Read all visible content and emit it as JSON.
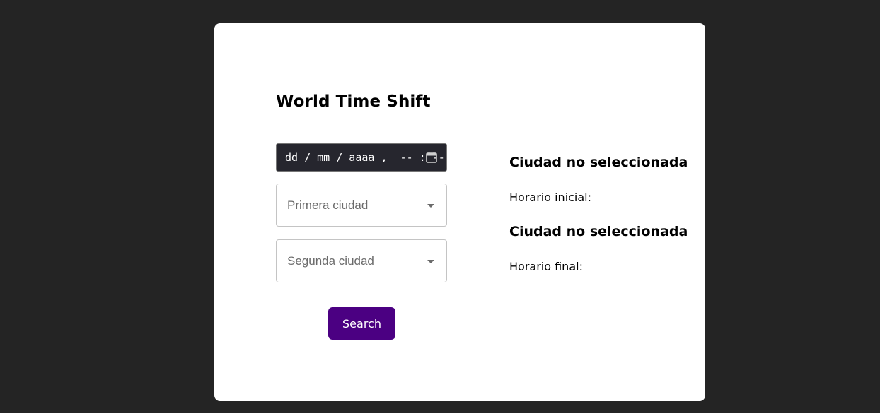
{
  "app": {
    "title": "World Time Shift"
  },
  "form": {
    "datetime_placeholder": "dd / mm / aaaa ,  -- : --",
    "first_city_placeholder": "Primera ciudad",
    "second_city_placeholder": "Segunda ciudad",
    "search_label": "Search"
  },
  "results": {
    "first_city": "Ciudad no seleccionada",
    "initial_time_label": "Horario inicial:",
    "second_city": "Ciudad no seleccionada",
    "final_time_label": "Horario final:"
  },
  "colors": {
    "background": "#242424",
    "card": "#ffffff",
    "accent": "#4b0082",
    "datetime_bg": "#26262e"
  },
  "icons": {
    "datetime": "calendar-icon",
    "select": "chevron-down-icon"
  }
}
